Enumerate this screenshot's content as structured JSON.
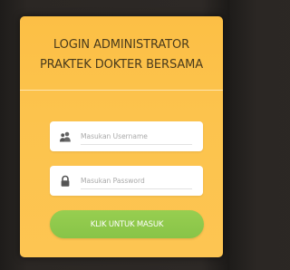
{
  "login": {
    "title_line1": "LOGIN ADMINISTRATOR",
    "title_line2": "PRAKTEK DOKTER BERSAMA",
    "username": {
      "placeholder": "Masukan Username",
      "value": "",
      "icon": "users-icon"
    },
    "password": {
      "placeholder": "Masukan Password",
      "value": "",
      "icon": "lock-icon"
    },
    "submit_label": "KLIK UNTUK MASUK"
  },
  "colors": {
    "card_background": "#fcc34d",
    "title_text": "#4a3b1c",
    "button": "#8fc94c",
    "button_text": "#ffffff",
    "page_background": "#2b2724"
  }
}
